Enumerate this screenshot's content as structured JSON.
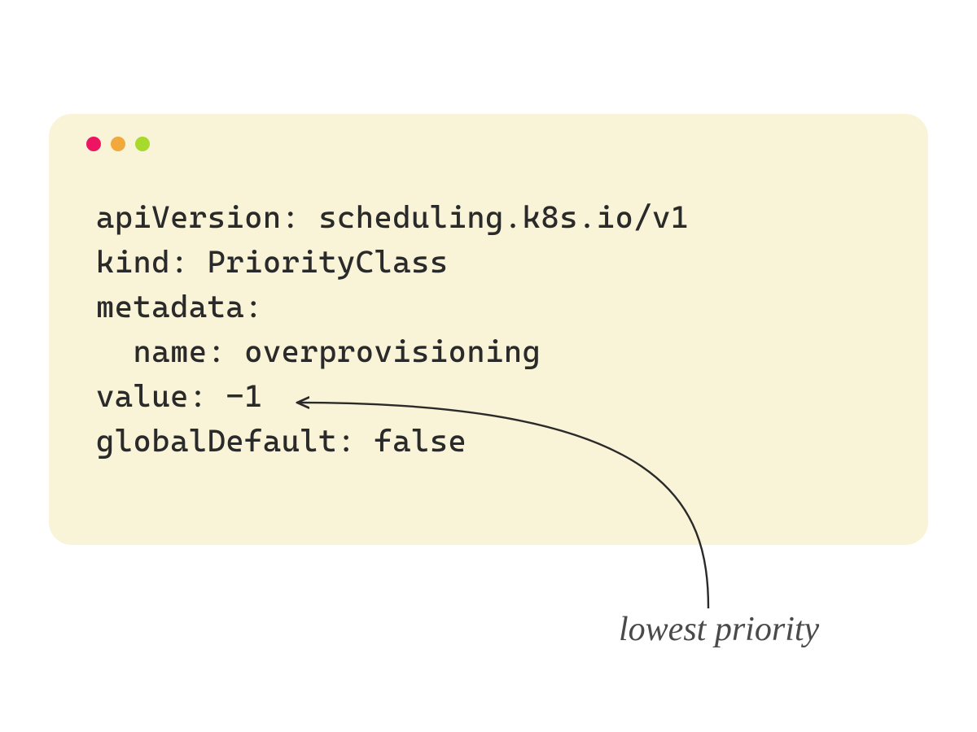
{
  "window": {
    "traffic_colors": {
      "close": "#ec1561",
      "min": "#f0a93a",
      "max": "#a8d92d"
    }
  },
  "code": {
    "lines": [
      "apiVersion: scheduling.k8s.io/v1",
      "kind: PriorityClass",
      "metadata:",
      "  name: overprovisioning",
      "value: -1",
      "globalDefault: false"
    ]
  },
  "annotation": {
    "label": "lowest priority"
  }
}
